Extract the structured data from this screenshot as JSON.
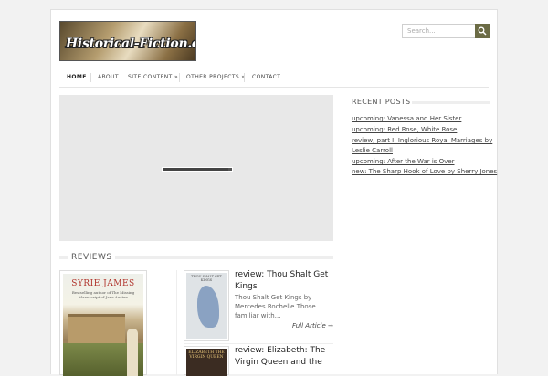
{
  "header": {
    "logo_text": "Historical-Fiction.com",
    "search_placeholder": "Search...",
    "search_icon": "search-icon"
  },
  "nav": {
    "items": [
      {
        "label": "HOME"
      },
      {
        "label": "ABOUT"
      },
      {
        "label": "SITE CONTENT »"
      },
      {
        "label": "OTHER PROJECTS »"
      },
      {
        "label": "CONTACT"
      }
    ]
  },
  "slider": {
    "progress": 0.95
  },
  "sidebar": {
    "title": "RECENT POSTS",
    "posts": [
      {
        "label": "upcoming: Vanessa and Her Sister"
      },
      {
        "label": "upcoming: Red Rose, White Rose"
      },
      {
        "label": "review, part I: Inglorious Royal Marriages by"
      },
      {
        "label": "Leslie Carroll"
      },
      {
        "label": "upcoming: After the War is Over"
      },
      {
        "label": "new: The Sharp Hook of Love by Sherry Jones"
      }
    ]
  },
  "reviews": {
    "title": "REVIEWS",
    "featured_cover": {
      "author": "SYRIE JAMES",
      "blurb": "Bestselling author of The Missing Manuscript of Jane Austen"
    },
    "items": [
      {
        "title_line1": "review: Thou Shalt Get",
        "title_line2": "Kings",
        "excerpt_line1": "Thou Shalt Get Kings by",
        "excerpt_line2": "Mercedes Rochelle Those",
        "excerpt_line3": "familiar with…",
        "link": "Full Article →",
        "thumb_text": "THOU SHALT GET KINGS"
      },
      {
        "title_line1": "review: Elizabeth: The",
        "title_line2": "Virgin Queen and the",
        "thumb_text": "ELIZABETH THE VIRGIN QUEEN"
      }
    ]
  }
}
